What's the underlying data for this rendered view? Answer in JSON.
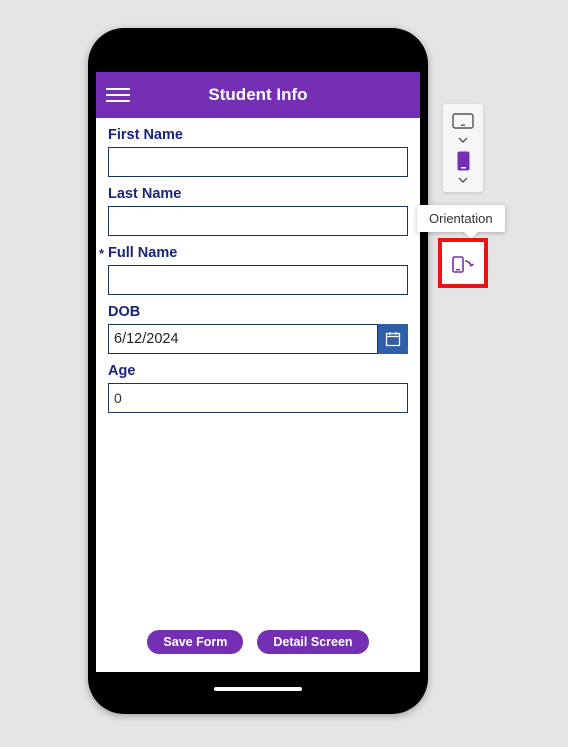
{
  "header": {
    "title": "Student Info"
  },
  "fields": {
    "firstName": {
      "label": "First Name",
      "value": ""
    },
    "lastName": {
      "label": "Last Name",
      "value": ""
    },
    "fullName": {
      "label": "Full Name",
      "value": "",
      "required": "*"
    },
    "dob": {
      "label": "DOB",
      "value": "6/12/2024"
    },
    "age": {
      "label": "Age",
      "value": "0"
    }
  },
  "buttons": {
    "save": "Save Form",
    "detail": "Detail Screen"
  },
  "sideToolbar": {
    "tooltip": "Orientation"
  },
  "colors": {
    "brand": "#742fb5",
    "labelText": "#1a237e",
    "dateButton": "#2f5fa8",
    "highlight": "#e11"
  }
}
